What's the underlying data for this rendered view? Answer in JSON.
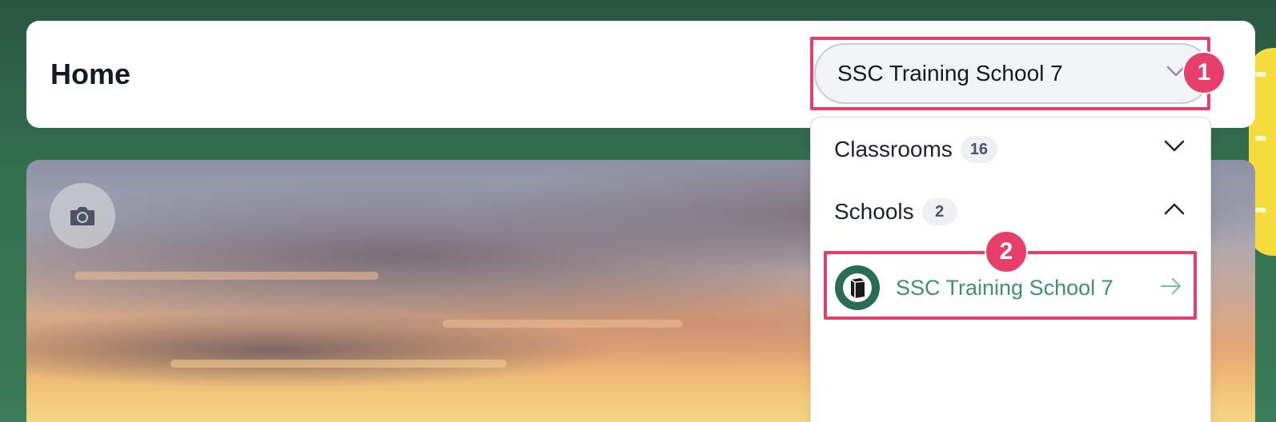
{
  "header": {
    "title": "Home"
  },
  "school_selector": {
    "selected": "SSC Training School 7"
  },
  "dropdown": {
    "sections": [
      {
        "label": "Classrooms",
        "count": "16",
        "expanded": false
      },
      {
        "label": "Schools",
        "count": "2",
        "expanded": true
      }
    ],
    "schools": [
      {
        "name": "SSC Training School 7"
      }
    ]
  },
  "annotations": {
    "step1": "1",
    "step2": "2"
  },
  "colors": {
    "accent": "#e83e6b",
    "school_link": "#3f8f73",
    "background": "#336f4f"
  },
  "icons": {
    "camera": "camera-icon",
    "chevron_down": "chevron-down-icon",
    "chevron_up": "chevron-up-icon",
    "arrow_right": "arrow-right-icon",
    "school_logo": "school-logo-icon"
  }
}
